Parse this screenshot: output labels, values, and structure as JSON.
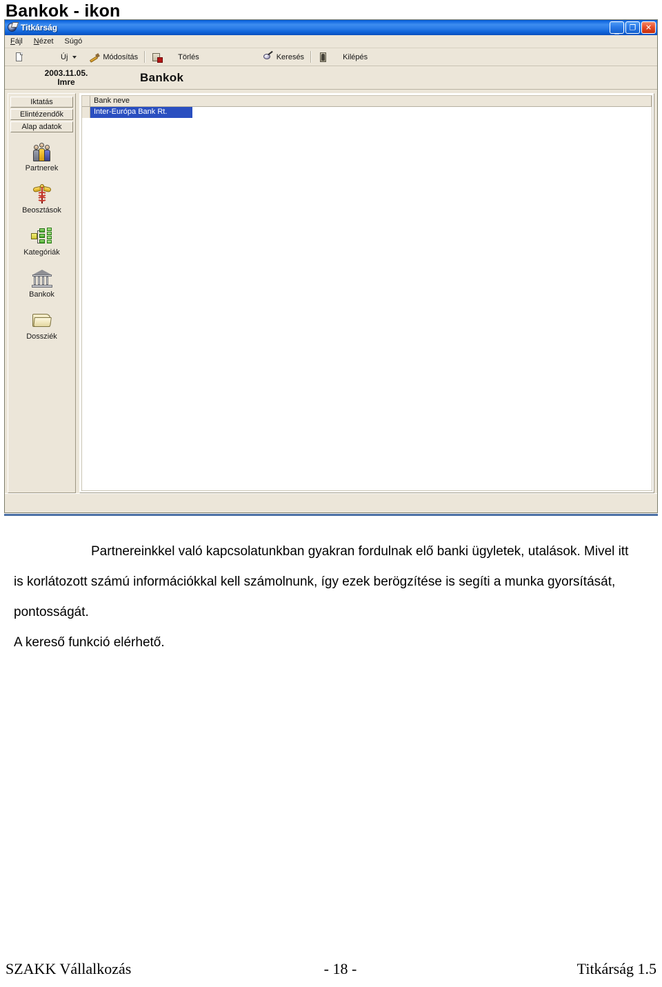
{
  "document": {
    "heading": "Bankok - ikon",
    "paragraphs": [
      "Partnereinkkel való kapcsolatunkban gyakran fordulnak elő banki ügyletek, utalások. Mivel itt is korlátozott számú információkkal kell számolnunk, így ezek berögzítése is segíti a munka gyorsítását, pontosságát.",
      "A kereső funkció elérhető."
    ]
  },
  "footer": {
    "left": "SZAKK Vállalkozás",
    "center": "- 18 -",
    "right": "Titkárság 1.5"
  },
  "window": {
    "title": "Titkárság",
    "icon": "app-globe-icon",
    "controls": {
      "minimize": "_",
      "restore": "❐",
      "close": "✕"
    },
    "menu": [
      {
        "label": "Fájl",
        "accel": "F"
      },
      {
        "label": "Nézet",
        "accel": "N"
      },
      {
        "label": "Súgó",
        "accel": "S"
      }
    ],
    "toolbar": [
      {
        "label": "",
        "icon": "new-document-icon"
      },
      {
        "label": "Új",
        "icon": "",
        "dropdown": true
      },
      {
        "label": "Módosítás",
        "icon": "pencil-icon"
      },
      {
        "label": "Törlés",
        "icon": "delete-icon"
      },
      {
        "label": "Keresés",
        "icon": "search-icon"
      },
      {
        "label": "Kilépés",
        "icon": "exit-icon"
      }
    ],
    "caption": {
      "date": "2003.11.05.",
      "user": "Imre",
      "title": "Bankok"
    },
    "sidebar": {
      "tabs": [
        "Iktatás",
        "Elintézendők",
        "Alap adatok"
      ],
      "items": [
        {
          "label": "Partnerek",
          "icon": "people-icon"
        },
        {
          "label": "Beosztások",
          "icon": "caduceus-icon"
        },
        {
          "label": "Kategóriák",
          "icon": "tree-icon"
        },
        {
          "label": "Bankok",
          "icon": "bank-building-icon"
        },
        {
          "label": "Dossziék",
          "icon": "folder-icon"
        }
      ]
    },
    "grid": {
      "columns": [
        "Bank neve"
      ],
      "rows": [
        {
          "cells": [
            "Inter-Európa Bank Rt."
          ],
          "selected": true
        }
      ]
    },
    "colors": {
      "window_bg": "#ece6d9",
      "titlebar_blue": "#1168e0",
      "selection_blue": "#2a4fc0",
      "rule_blue": "#4a6fa5",
      "grid_bg": "#ffffff"
    }
  }
}
